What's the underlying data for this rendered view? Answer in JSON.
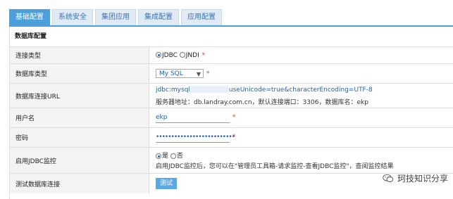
{
  "tabs": [
    "基础配置",
    "系统安全",
    "集团应用",
    "集成配置",
    "应用配置"
  ],
  "section_title": "数据库配置",
  "rows": {
    "conn_type": {
      "label": "连接类型",
      "opt1": "JDBC",
      "opt2": "JNDI",
      "req": "*"
    },
    "db_type": {
      "label": "数据库类型",
      "value": "My SQL",
      "req": "*"
    },
    "url": {
      "label": "数据库连接URL",
      "value_left": "jdbc:mysql",
      "value_right": "useUnicode=true&characterEncoding=UTF-8",
      "hint": "服务器地址：db.landray.com.cn，默认连接端口：3306，数据库名：ekp"
    },
    "user": {
      "label": "用户名",
      "value": "ekp",
      "req": "*"
    },
    "pwd": {
      "label": "密码",
      "value": "••••••••••••••••••••••••••",
      "req": "*"
    },
    "jdbc_monitor": {
      "label": "启用JDBC监控",
      "opt1": "是",
      "opt2": "否",
      "hint": "启用JDBC监控后，您可以在\"管理员工具箱-请求监控-查看JDBC监控\"，查阅监控结果"
    },
    "test_conn": {
      "label": "测试数据库连接",
      "button": "测试"
    }
  },
  "watermark": {
    "text": "珂技知识分享",
    "icon": "wechat-icon"
  },
  "colors": {
    "accent": "#4b9fdb",
    "required": "#e03a2f",
    "link": "#1b5fb8"
  }
}
